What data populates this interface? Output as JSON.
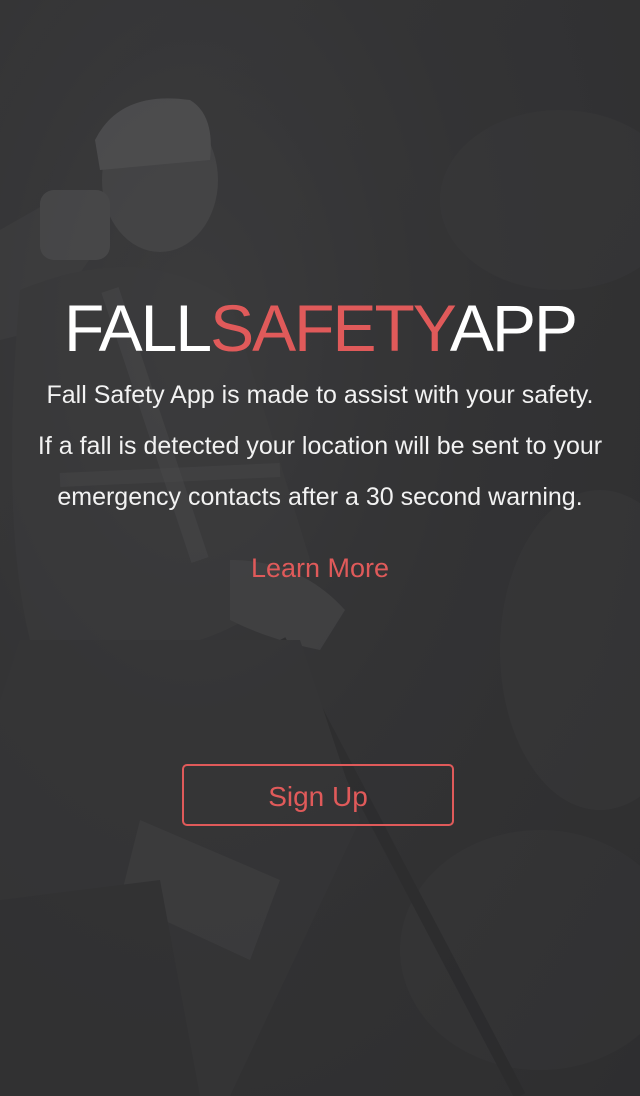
{
  "title": {
    "part1": "FALL",
    "part2": "SAFETY",
    "part3": "APP"
  },
  "description": {
    "line1": "Fall Safety App is made to assist with your safety.",
    "line2": "If a fall is detected your location will be sent to your",
    "line3": "emergency contacts after a 30 second warning."
  },
  "learn_more_label": "Learn More",
  "signup_label": "Sign Up",
  "colors": {
    "accent": "#e05a5a",
    "background": "#3a3a3b",
    "text": "#ffffff"
  },
  "background_image": "worker-climbing-photo"
}
